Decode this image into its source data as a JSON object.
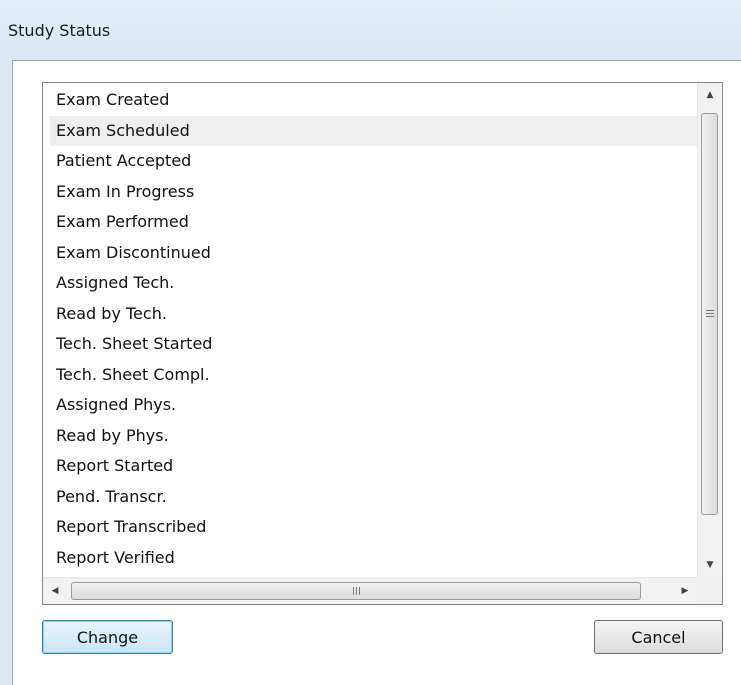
{
  "window": {
    "title": "Study Status"
  },
  "status_list": {
    "items": [
      "Exam Created",
      "Exam Scheduled",
      "Patient Accepted",
      "Exam In Progress",
      "Exam Performed",
      "Exam Discontinued",
      "Assigned Tech.",
      "Read by Tech.",
      "Tech. Sheet Started",
      "Tech. Sheet Compl.",
      "Assigned Phys.",
      "Read by Phys.",
      "Report Started",
      "Pend. Transcr.",
      "Report Transcribed",
      "Report Verified"
    ],
    "highlighted_item": "Exam Scheduled"
  },
  "buttons": {
    "change_label": "Change",
    "cancel_label": "Cancel"
  },
  "icons": {
    "scroll_up": "triangle-up-icon",
    "scroll_down": "triangle-down-icon",
    "scroll_left": "triangle-left-icon",
    "scroll_right": "triangle-right-icon"
  },
  "colors": {
    "title_bar": "#dbe6f2",
    "hover_row": "#eeeeee",
    "default_button_border": "#3c7fb1"
  }
}
